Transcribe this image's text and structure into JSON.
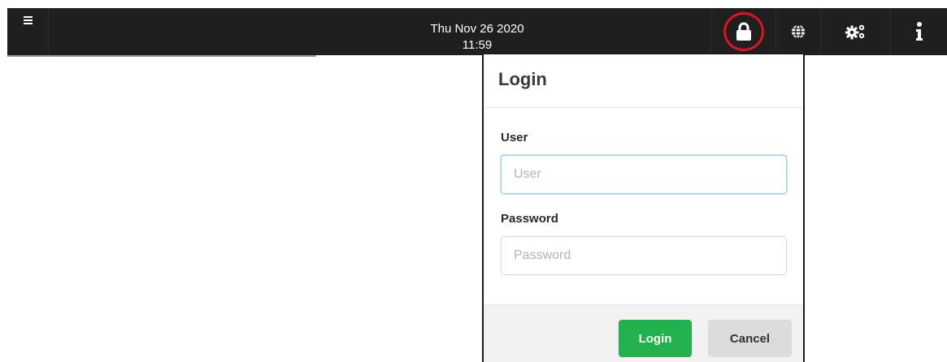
{
  "header": {
    "date": "Thu Nov 26 2020",
    "time": "11:59",
    "menu_icon": "hamburger-menu-icon",
    "icons": [
      "lock-icon",
      "globe-icon",
      "gears-icon",
      "info-icon"
    ]
  },
  "colors": {
    "topbar_bg": "#1f1f1f",
    "highlight_ring": "#e1121c",
    "login_button": "#22b14c",
    "cancel_button": "#dcdcdc"
  },
  "login_dialog": {
    "title": "Login",
    "user_label": "User",
    "user_placeholder": "User",
    "user_value": "",
    "password_label": "Password",
    "password_placeholder": "Password",
    "password_value": "",
    "login_button": "Login",
    "cancel_button": "Cancel"
  }
}
